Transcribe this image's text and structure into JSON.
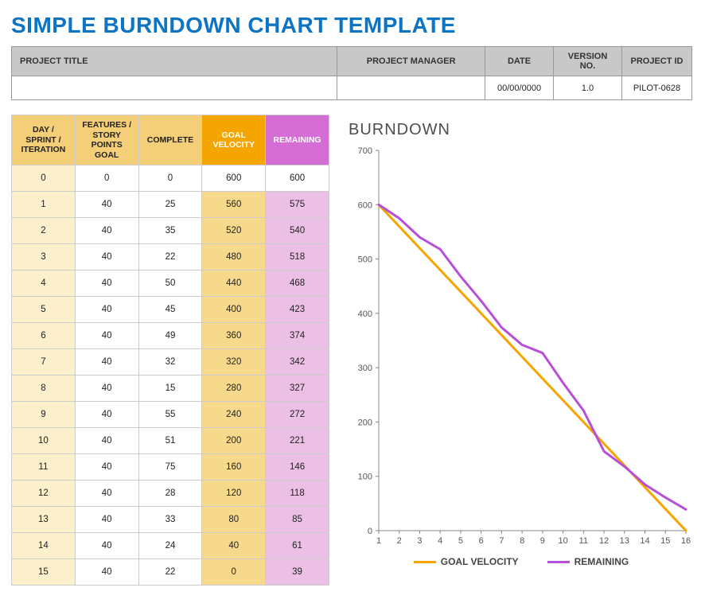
{
  "title": "SIMPLE BURNDOWN CHART TEMPLATE",
  "meta": {
    "headers": {
      "project_title": "PROJECT TITLE",
      "project_manager": "PROJECT MANAGER",
      "date": "DATE",
      "version": "VERSION NO.",
      "project_id": "PROJECT ID"
    },
    "values": {
      "project_title": "",
      "project_manager": "",
      "date": "00/00/0000",
      "version": "1.0",
      "project_id": "PILOT-0628"
    }
  },
  "table": {
    "headers": {
      "day": "DAY / SPRINT / ITERATION",
      "features": "FEATURES / STORY POINTS GOAL",
      "complete": "COMPLETE",
      "goal": "GOAL VELOCITY",
      "remaining": "REMAINING"
    },
    "rows": [
      {
        "day": "0",
        "features": "0",
        "complete": "0",
        "goal": "600",
        "remaining": "600"
      },
      {
        "day": "1",
        "features": "40",
        "complete": "25",
        "goal": "560",
        "remaining": "575"
      },
      {
        "day": "2",
        "features": "40",
        "complete": "35",
        "goal": "520",
        "remaining": "540"
      },
      {
        "day": "3",
        "features": "40",
        "complete": "22",
        "goal": "480",
        "remaining": "518"
      },
      {
        "day": "4",
        "features": "40",
        "complete": "50",
        "goal": "440",
        "remaining": "468"
      },
      {
        "day": "5",
        "features": "40",
        "complete": "45",
        "goal": "400",
        "remaining": "423"
      },
      {
        "day": "6",
        "features": "40",
        "complete": "49",
        "goal": "360",
        "remaining": "374"
      },
      {
        "day": "7",
        "features": "40",
        "complete": "32",
        "goal": "320",
        "remaining": "342"
      },
      {
        "day": "8",
        "features": "40",
        "complete": "15",
        "goal": "280",
        "remaining": "327"
      },
      {
        "day": "9",
        "features": "40",
        "complete": "55",
        "goal": "240",
        "remaining": "272"
      },
      {
        "day": "10",
        "features": "40",
        "complete": "51",
        "goal": "200",
        "remaining": "221"
      },
      {
        "day": "11",
        "features": "40",
        "complete": "75",
        "goal": "160",
        "remaining": "146"
      },
      {
        "day": "12",
        "features": "40",
        "complete": "28",
        "goal": "120",
        "remaining": "118"
      },
      {
        "day": "13",
        "features": "40",
        "complete": "33",
        "goal": "80",
        "remaining": "85"
      },
      {
        "day": "14",
        "features": "40",
        "complete": "24",
        "goal": "40",
        "remaining": "61"
      },
      {
        "day": "15",
        "features": "40",
        "complete": "22",
        "goal": "0",
        "remaining": "39"
      }
    ]
  },
  "chart_title": "BURNDOWN",
  "chart_data": {
    "type": "line",
    "title": "BURNDOWN",
    "xlabel": "",
    "ylabel": "",
    "ylim": [
      0,
      700
    ],
    "yticks": [
      0,
      100,
      200,
      300,
      400,
      500,
      600,
      700
    ],
    "xticks": [
      1,
      2,
      3,
      4,
      5,
      6,
      7,
      8,
      9,
      10,
      11,
      12,
      13,
      14,
      15,
      16
    ],
    "x": [
      1,
      2,
      3,
      4,
      5,
      6,
      7,
      8,
      9,
      10,
      11,
      12,
      13,
      14,
      15,
      16
    ],
    "series": [
      {
        "name": "GOAL VELOCITY",
        "color": "#f5a500",
        "values": [
          600,
          560,
          520,
          480,
          440,
          400,
          360,
          320,
          280,
          240,
          200,
          160,
          120,
          80,
          40,
          0
        ]
      },
      {
        "name": "REMAINING",
        "color": "#b84fd8",
        "values": [
          600,
          575,
          540,
          518,
          468,
          423,
          374,
          342,
          327,
          272,
          221,
          146,
          118,
          85,
          61,
          39
        ]
      }
    ],
    "legend": [
      "GOAL VELOCITY",
      "REMAINING"
    ]
  }
}
